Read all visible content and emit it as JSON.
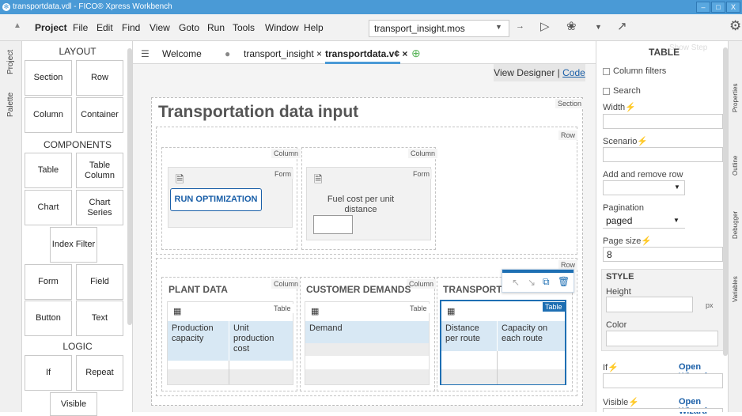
{
  "window": {
    "title": "transportdata.vdl - FICO® Xpress Workbench",
    "controls": [
      "–",
      "□",
      "X"
    ]
  },
  "menu": {
    "items": [
      "Project",
      "File",
      "Edit",
      "Find",
      "View",
      "Goto",
      "Run",
      "Tools",
      "Window",
      "Help"
    ],
    "file_select": "transport_insight.mos"
  },
  "leftrail": {
    "project": "Project",
    "palette": "Palette"
  },
  "palette": {
    "layout_header": "LAYOUT",
    "layout": [
      "Section",
      "Row",
      "Column",
      "Container"
    ],
    "components_header": "COMPONENTS",
    "components": [
      "Table",
      "Table Column",
      "Chart",
      "Chart Series",
      "Index Filter",
      "Form",
      "Field",
      "Button",
      "Text"
    ],
    "logic_header": "LOGIC",
    "logic": [
      "If",
      "Repeat",
      "Visible"
    ]
  },
  "tabs": {
    "welcome": "Welcome",
    "insight": "transport_insight ×",
    "active": "transportdata.v¢ ×"
  },
  "viewdesigner": {
    "designer": "View Designer",
    "sep": "|",
    "code": "Code"
  },
  "canvas": {
    "section_tag": "Section",
    "title": "Transportation data input",
    "row_tag": "Row",
    "column_tag": "Column",
    "form_tag": "Form",
    "table_tag": "Table",
    "run_button": "RUN OPTIMIZATION",
    "fuel_label": "Fuel cost per unit distance",
    "plant_header": "PLANT DATA",
    "customer_header": "CUSTOMER DEMANDS",
    "transport_header": "TRANSPORTA",
    "plant_cols": [
      "Production capacity",
      "Unit production cost"
    ],
    "customer_cols": [
      "Demand"
    ],
    "transport_cols": [
      "Distance per route",
      "Capacity on each route"
    ]
  },
  "rightpanel": {
    "title": "TABLE",
    "faded": "Show Step",
    "column_filters": "Column filters",
    "search": "Search",
    "width": "Width",
    "scenario": "Scenario",
    "add_remove_row": "Add and remove row",
    "pagination": "Pagination",
    "pagination_value": "paged",
    "page_size": "Page size",
    "page_size_value": "8",
    "style_header": "STYLE",
    "height": "Height",
    "px": "px",
    "color": "Color",
    "if": "If",
    "visible": "Visible",
    "open_wizard": "Open Wizard"
  },
  "rightrail": {
    "a": "Properties",
    "b": "Outline",
    "c": "Debugger",
    "d": "Variables"
  },
  "colors": {
    "accent": "#4a9ad6",
    "link": "#1a5fa8",
    "table_header": "#d8e8f4",
    "selected": "#1e6fb3"
  }
}
